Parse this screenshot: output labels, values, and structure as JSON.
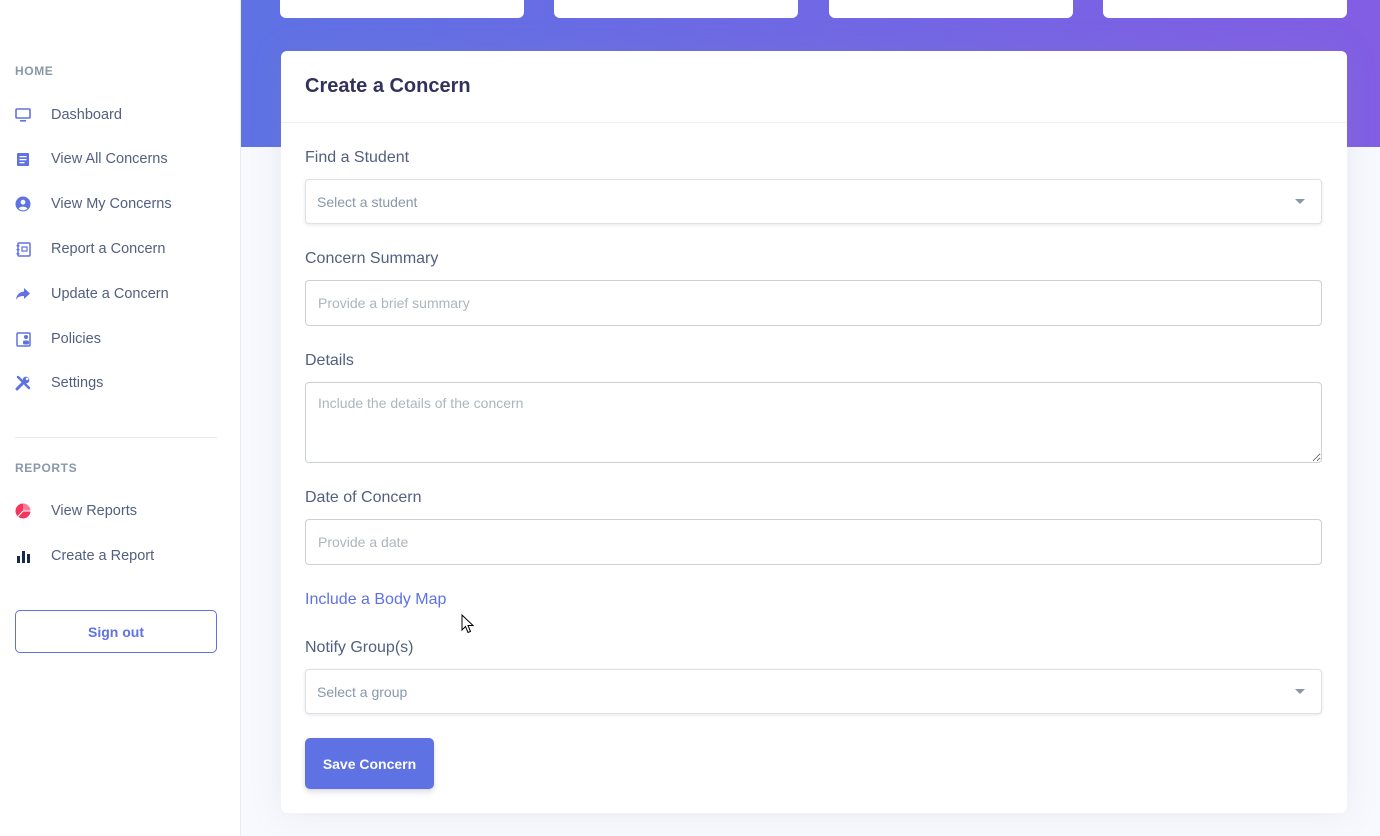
{
  "sidebar": {
    "home_heading": "HOME",
    "items": [
      {
        "label": "Dashboard",
        "icon": "monitor-icon"
      },
      {
        "label": "View All Concerns",
        "icon": "document-list-icon"
      },
      {
        "label": "View My Concerns",
        "icon": "user-circle-icon"
      },
      {
        "label": "Report a Concern",
        "icon": "notebook-icon"
      },
      {
        "label": "Update a Concern",
        "icon": "share-arrow-icon"
      },
      {
        "label": "Policies",
        "icon": "policy-book-icon"
      },
      {
        "label": "Settings",
        "icon": "tools-icon"
      }
    ],
    "reports_heading": "REPORTS",
    "report_items": [
      {
        "label": "View Reports",
        "icon": "pie-chart-icon"
      },
      {
        "label": "Create a Report",
        "icon": "bar-chart-icon"
      }
    ],
    "signout_label": "Sign out"
  },
  "form": {
    "title": "Create a Concern",
    "student_label": "Find a Student",
    "student_placeholder": "Select a student",
    "summary_label": "Concern Summary",
    "summary_placeholder": "Provide a brief summary",
    "details_label": "Details",
    "details_placeholder": "Include the details of the concern",
    "date_label": "Date of Concern",
    "date_placeholder": "Provide a date",
    "body_map_link": "Include a Body Map",
    "notify_label": "Notify Group(s)",
    "notify_placeholder": "Select a group",
    "save_label": "Save Concern"
  },
  "colors": {
    "primary": "#5e72e4",
    "gradient_end": "#825ee4",
    "danger": "#f5365c"
  }
}
